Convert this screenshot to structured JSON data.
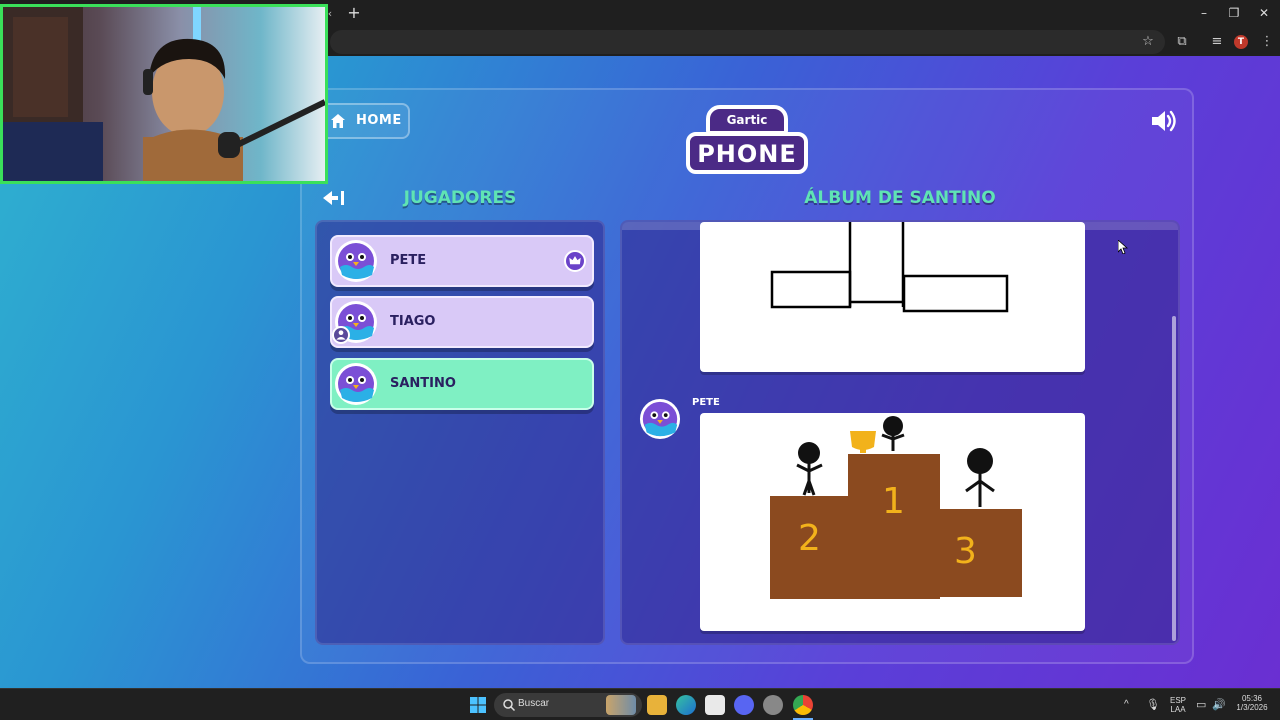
{
  "browser": {
    "new_tab_glyph": "+",
    "window_controls": {
      "minimize": "–",
      "restore": "❐",
      "close": "✕"
    },
    "profile_initial": "T"
  },
  "game": {
    "home_label": "HOME",
    "logo": {
      "top_text": "Gartic",
      "bottom_text": "PHONE"
    },
    "players_title": "JUGADORES",
    "album_title": "ÁLBUM DE SANTINO",
    "players": [
      {
        "name": "PETE",
        "state": "normal",
        "badge": "crown-icon"
      },
      {
        "name": "TIAGO",
        "state": "normal",
        "badge": "user-icon"
      },
      {
        "name": "SANTINO",
        "state": "active",
        "badge": ""
      }
    ],
    "album": {
      "entries": [
        {
          "author": "",
          "kind": "drawing"
        },
        {
          "author": "PETE",
          "kind": "drawing"
        }
      ],
      "podium_numbers": [
        "2",
        "1",
        "3"
      ]
    }
  },
  "taskbar": {
    "search_placeholder": "Buscar",
    "language": "ESP",
    "language_sub": "LAA",
    "time": "05:36",
    "date": "1/3/2026"
  },
  "colors": {
    "accent_title": "#5fe3b4",
    "active_player": "#7ff0c3",
    "player_card": "#d9c9f7",
    "podium_brown": "#8b4a1f",
    "podium_numbers": "#f2b21b",
    "webcam_border": "#3ae05a"
  }
}
